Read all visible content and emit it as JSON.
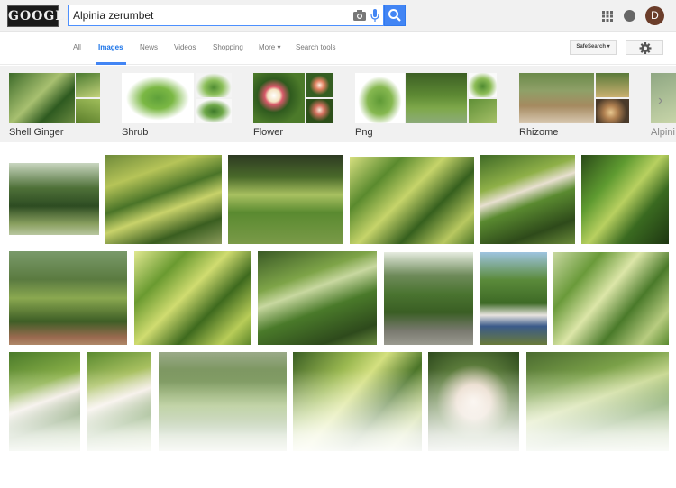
{
  "header": {
    "logo_text": "GOOGLE",
    "search_value": "Alpinia zerumbet",
    "avatar_initial": "D"
  },
  "nav": {
    "tabs": [
      {
        "label": "All"
      },
      {
        "label": "Images"
      },
      {
        "label": "News"
      },
      {
        "label": "Videos"
      },
      {
        "label": "Shopping"
      },
      {
        "label": "More ▾"
      },
      {
        "label": "Search tools"
      }
    ],
    "safesearch_label": "SafeSearch ▾"
  },
  "related": [
    {
      "label": "Shell Ginger"
    },
    {
      "label": "Shrub"
    },
    {
      "label": "Flower"
    },
    {
      "label": "Png"
    },
    {
      "label": "Rhizome"
    },
    {
      "label": "Alpini"
    }
  ],
  "colors": {
    "accent": "#4285f4",
    "topbar": "#f1f1f1",
    "leaf_dark": "#2f5a1e",
    "leaf_light": "#b8c94a"
  }
}
